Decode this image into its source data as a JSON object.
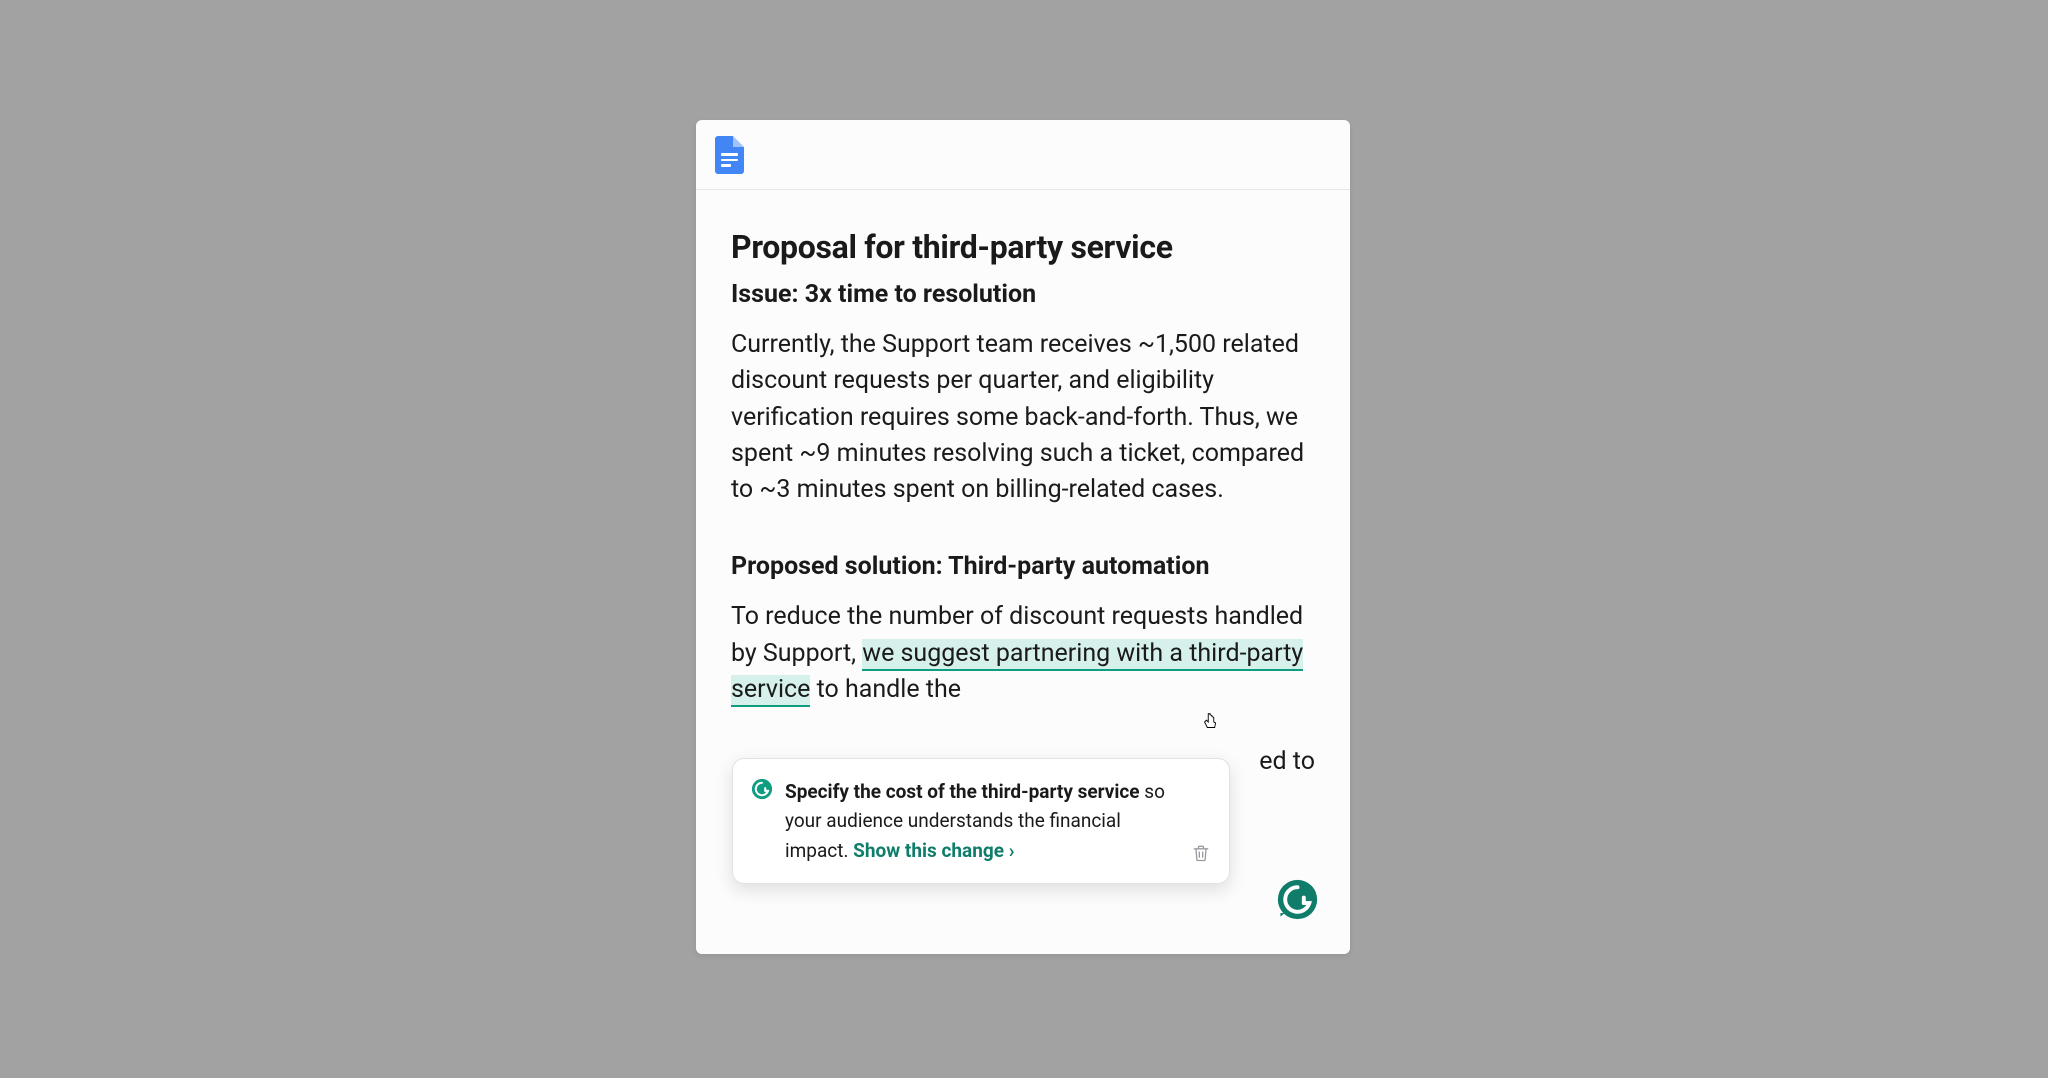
{
  "document": {
    "title": "Proposal for third-party service",
    "issue_heading": "Issue: 3x time to resolution",
    "issue_body": "Currently, the Support team receives ~1,500 related discount requests per quarter, and eligibility verification requires some back-and-forth. Thus, we spent ~9 minutes resolving such a ticket, compared to ~3 minutes spent on billing-related cases.",
    "solution_heading": "Proposed solution: Third-party automation",
    "solution_pre": "To reduce the number of discount requests handled by Support, ",
    "solution_highlight": "we suggest partnering with a third-party service",
    "solution_post": " to handle the",
    "solution_tail_visible": "ed to"
  },
  "suggestion": {
    "bold_text": "Specify the cost of the third-party service",
    "rest_text": " so your audience understands the financial impact. ",
    "action_label": "Show this change ›"
  },
  "icons": {
    "docs": "google-docs-icon",
    "grammarly": "grammarly-icon",
    "trash": "trash-icon",
    "cursor": "pointer-cursor"
  },
  "colors": {
    "accent_green": "#0f7d6a",
    "highlight_bg": "#d6f1eb",
    "docs_blue": "#4285f4"
  }
}
